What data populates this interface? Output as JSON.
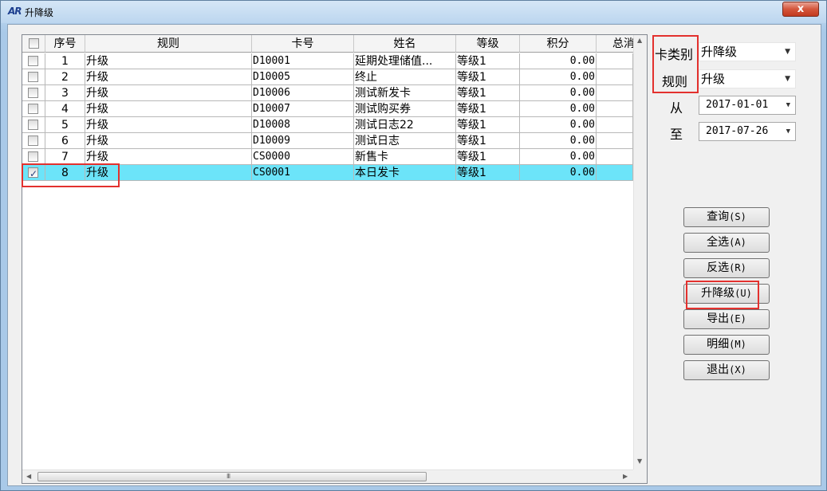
{
  "window": {
    "title": "升降级",
    "close_label": "x"
  },
  "grid": {
    "columns": [
      "序号",
      "规则",
      "卡号",
      "姓名",
      "等级",
      "积分",
      "总消"
    ],
    "rows": [
      {
        "checked": false,
        "no": "1",
        "rule": "升级",
        "card": "D10001",
        "name": "延期处理储值...",
        "level": "等级1",
        "points": "0.00"
      },
      {
        "checked": false,
        "no": "2",
        "rule": "升级",
        "card": "D10005",
        "name": "终止",
        "level": "等级1",
        "points": "0.00"
      },
      {
        "checked": false,
        "no": "3",
        "rule": "升级",
        "card": "D10006",
        "name": "测试新发卡",
        "level": "等级1",
        "points": "0.00"
      },
      {
        "checked": false,
        "no": "4",
        "rule": "升级",
        "card": "D10007",
        "name": "测试购买券",
        "level": "等级1",
        "points": "0.00"
      },
      {
        "checked": false,
        "no": "5",
        "rule": "升级",
        "card": "D10008",
        "name": "测试日志22",
        "level": "等级1",
        "points": "0.00"
      },
      {
        "checked": false,
        "no": "6",
        "rule": "升级",
        "card": "D10009",
        "name": "测试日志",
        "level": "等级1",
        "points": "0.00"
      },
      {
        "checked": false,
        "no": "7",
        "rule": "升级",
        "card": "CS0000",
        "name": "新售卡",
        "level": "等级1",
        "points": "0.00"
      },
      {
        "checked": true,
        "no": "8",
        "rule": "升级",
        "card": "CS0001",
        "name": "本日发卡",
        "level": "等级1",
        "points": "0.00"
      }
    ],
    "selected_row": 7,
    "grip": "III"
  },
  "filters": {
    "card_type_label": "卡类别",
    "card_type_value": "升降级",
    "rule_label": "规则",
    "rule_value": "升级",
    "from_label": "从",
    "from_value": "2017-01-01",
    "to_label": "至",
    "to_value": "2017-07-26"
  },
  "buttons": {
    "query": "查询",
    "query_key": "(S)",
    "select_all": "全选",
    "select_all_key": "(A)",
    "invert": "反选",
    "invert_key": "(R)",
    "upgrade": "升降级",
    "upgrade_key": "(U)",
    "export": "导出",
    "export_key": "(E)",
    "detail": "明细",
    "detail_key": "(M)",
    "exit": "退出",
    "exit_key": "(X)"
  },
  "colors": {
    "highlight": "#e3312e",
    "selected_row": "#6ce4f9"
  }
}
